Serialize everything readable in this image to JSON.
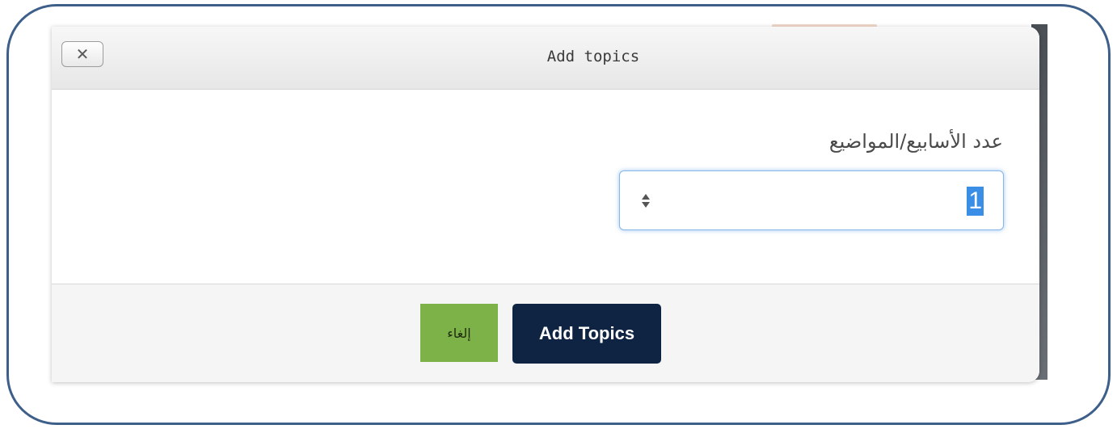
{
  "dialog": {
    "title": "Add topics",
    "close_icon": "✕"
  },
  "form": {
    "label": "عدد الأسابيع/المواضيع",
    "value": "1"
  },
  "footer": {
    "cancel_label": "إلغاء",
    "submit_label": "Add Topics"
  },
  "colors": {
    "frame_border": "#3e5f8a",
    "cancel_bg": "#7db249",
    "submit_bg": "#0f2442",
    "focus_ring": "#86b7e8",
    "selection": "#3a8ee6"
  },
  "icons": {
    "close": "close-icon",
    "spinner": "spinner-arrows-icon"
  }
}
